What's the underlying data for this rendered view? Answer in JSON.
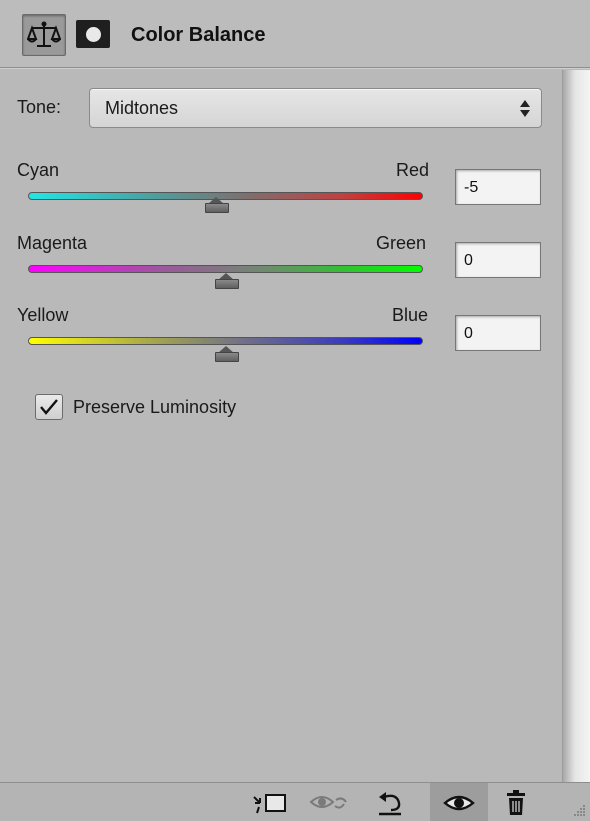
{
  "header": {
    "title": "Color Balance",
    "adjustment_icon": "scales-icon",
    "mask_icon": "layer-mask-icon"
  },
  "tone": {
    "label": "Tone:",
    "selected": "Midtones"
  },
  "sliders": [
    {
      "left_label": "Cyan",
      "right_label": "Red",
      "value": "-5",
      "position": 0.475
    },
    {
      "left_label": "Magenta",
      "right_label": "Green",
      "value": "0",
      "position": 0.5
    },
    {
      "left_label": "Yellow",
      "right_label": "Blue",
      "value": "0",
      "position": 0.5
    }
  ],
  "preserve_luminosity": {
    "label": "Preserve Luminosity",
    "checked": true
  },
  "footer": {
    "icons": [
      "clip-to-layer-icon",
      "view-previous-state-icon",
      "reset-icon",
      "toggle-visibility-icon",
      "delete-icon"
    ]
  }
}
